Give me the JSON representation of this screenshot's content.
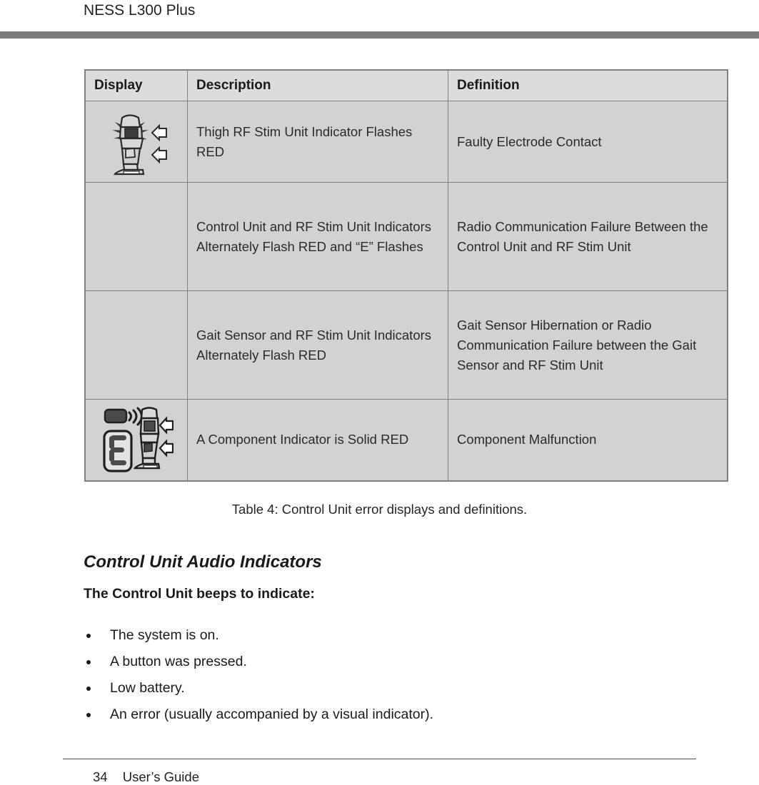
{
  "header": {
    "title": "NESS L300 Plus"
  },
  "table": {
    "columns": [
      "Display",
      "Description",
      "Definition"
    ],
    "rows": [
      {
        "display_icon": "thigh-rf-stim-unit-flashing-icon",
        "description": "Thigh RF Stim Unit Indicator Flashes RED",
        "definition": "Faulty Electrode Contact"
      },
      {
        "display_icon": "none",
        "description": "Control Unit and RF Stim Unit Indicators Alternately Flash RED and “E” Flashes",
        "definition": "Radio Communication Failure Between the Control Unit and RF Stim Unit"
      },
      {
        "display_icon": "none",
        "description": "Gait Sensor and RF Stim Unit Indicators Alternately Flash RED",
        "definition": "Gait Sensor Hibernation or Radio Communication Failure between the Gait Sensor and RF Stim Unit"
      },
      {
        "display_icon": "gait-sensor-e-display-leg-icon",
        "description": "A Component Indicator is Solid RED",
        "definition": "Component Malfunction"
      }
    ],
    "caption": "Table 4: Control Unit error displays and definitions."
  },
  "content": {
    "section_heading": "Control Unit Audio Indicators",
    "sub_heading": "The Control Unit beeps to indicate:",
    "bullets": [
      "The system is on.",
      "A button was pressed.",
      "Low battery.",
      "An error (usually accompanied by a visual indicator)."
    ]
  },
  "footer": {
    "page_number": "34",
    "label": "User’s Guide"
  },
  "colors": {
    "header_bar": "#7b7b7b",
    "table_header_fill": "#dcdcdc",
    "table_cell_fill": "#d2d2d2",
    "table_border": "#808080",
    "text": "#1a1a1a"
  }
}
